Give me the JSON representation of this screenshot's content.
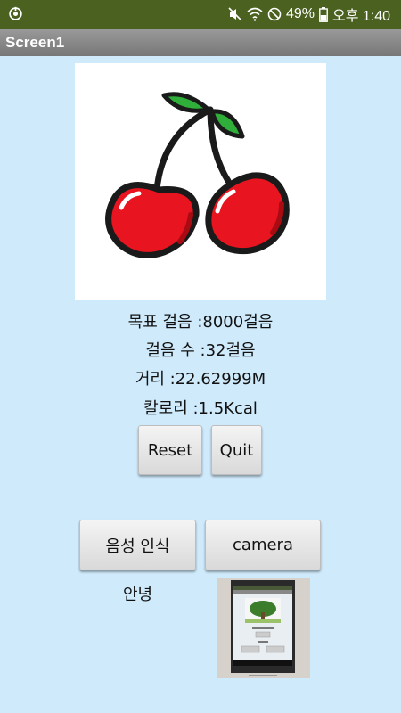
{
  "status_bar": {
    "battery_text": "49%",
    "time_text": "오후 1:40",
    "icons": [
      "app-notification-icon",
      "mute-icon",
      "wifi-icon",
      "do-not-disturb-icon",
      "battery-icon"
    ]
  },
  "app": {
    "screen_title": "Screen1"
  },
  "stats": {
    "goal": "목표 걸음 :8000걸음",
    "steps": "걸음 수 :32걸음",
    "distance": "거리 :22.62999M",
    "calories": "칼로리 :1.5Kcal"
  },
  "buttons": {
    "reset": "Reset",
    "quit": "Quit",
    "voice": "음성 인식",
    "camera": "camera"
  },
  "labels": {
    "hello": "안녕"
  },
  "colors": {
    "status_bar": "#4a6120",
    "background": "#cfeafb",
    "cherry_red": "#e8141f",
    "leaf_green": "#2fae3a"
  }
}
